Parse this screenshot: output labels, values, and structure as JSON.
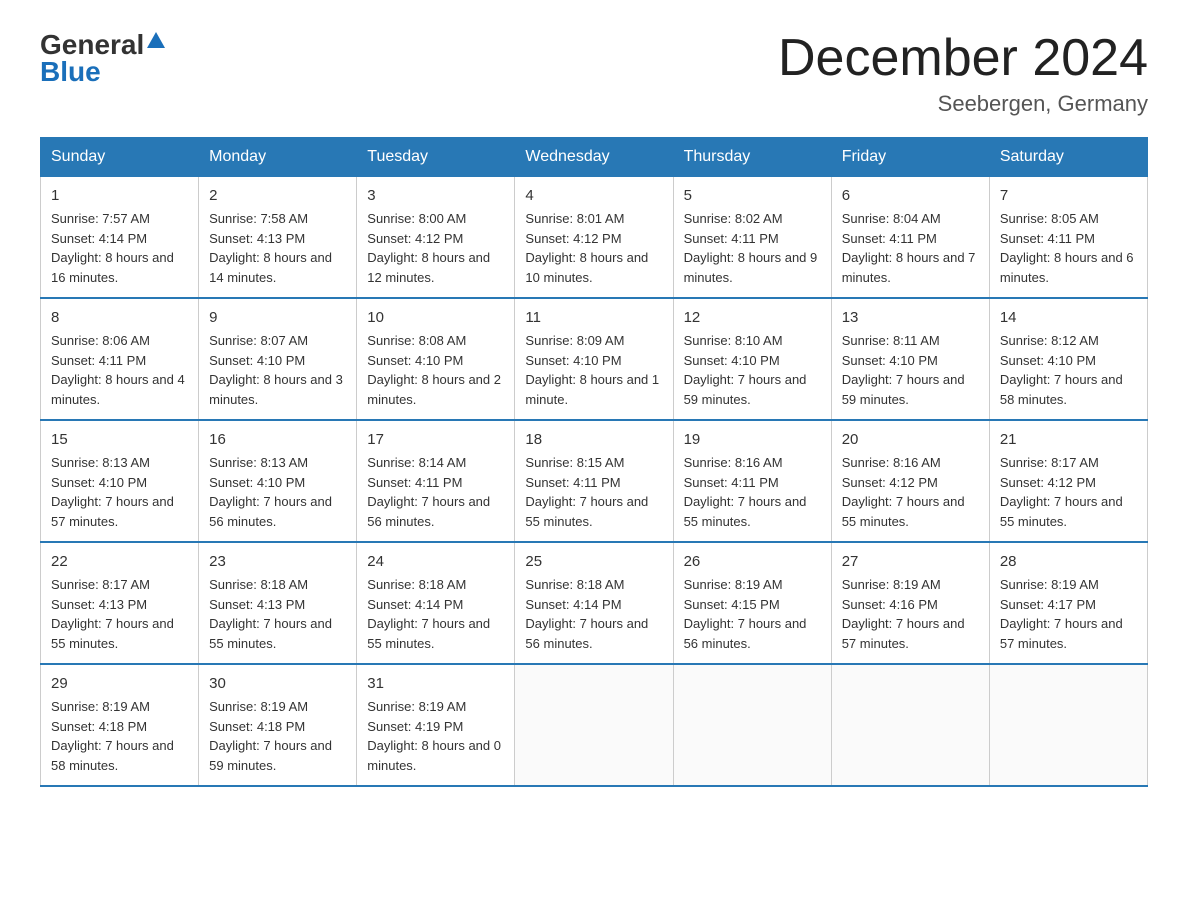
{
  "header": {
    "logo_general": "General",
    "logo_blue": "Blue",
    "month_title": "December 2024",
    "location": "Seebergen, Germany"
  },
  "weekdays": [
    "Sunday",
    "Monday",
    "Tuesday",
    "Wednesday",
    "Thursday",
    "Friday",
    "Saturday"
  ],
  "weeks": [
    [
      {
        "day": "1",
        "sunrise": "7:57 AM",
        "sunset": "4:14 PM",
        "daylight": "8 hours and 16 minutes."
      },
      {
        "day": "2",
        "sunrise": "7:58 AM",
        "sunset": "4:13 PM",
        "daylight": "8 hours and 14 minutes."
      },
      {
        "day": "3",
        "sunrise": "8:00 AM",
        "sunset": "4:12 PM",
        "daylight": "8 hours and 12 minutes."
      },
      {
        "day": "4",
        "sunrise": "8:01 AM",
        "sunset": "4:12 PM",
        "daylight": "8 hours and 10 minutes."
      },
      {
        "day": "5",
        "sunrise": "8:02 AM",
        "sunset": "4:11 PM",
        "daylight": "8 hours and 9 minutes."
      },
      {
        "day": "6",
        "sunrise": "8:04 AM",
        "sunset": "4:11 PM",
        "daylight": "8 hours and 7 minutes."
      },
      {
        "day": "7",
        "sunrise": "8:05 AM",
        "sunset": "4:11 PM",
        "daylight": "8 hours and 6 minutes."
      }
    ],
    [
      {
        "day": "8",
        "sunrise": "8:06 AM",
        "sunset": "4:11 PM",
        "daylight": "8 hours and 4 minutes."
      },
      {
        "day": "9",
        "sunrise": "8:07 AM",
        "sunset": "4:10 PM",
        "daylight": "8 hours and 3 minutes."
      },
      {
        "day": "10",
        "sunrise": "8:08 AM",
        "sunset": "4:10 PM",
        "daylight": "8 hours and 2 minutes."
      },
      {
        "day": "11",
        "sunrise": "8:09 AM",
        "sunset": "4:10 PM",
        "daylight": "8 hours and 1 minute."
      },
      {
        "day": "12",
        "sunrise": "8:10 AM",
        "sunset": "4:10 PM",
        "daylight": "7 hours and 59 minutes."
      },
      {
        "day": "13",
        "sunrise": "8:11 AM",
        "sunset": "4:10 PM",
        "daylight": "7 hours and 59 minutes."
      },
      {
        "day": "14",
        "sunrise": "8:12 AM",
        "sunset": "4:10 PM",
        "daylight": "7 hours and 58 minutes."
      }
    ],
    [
      {
        "day": "15",
        "sunrise": "8:13 AM",
        "sunset": "4:10 PM",
        "daylight": "7 hours and 57 minutes."
      },
      {
        "day": "16",
        "sunrise": "8:13 AM",
        "sunset": "4:10 PM",
        "daylight": "7 hours and 56 minutes."
      },
      {
        "day": "17",
        "sunrise": "8:14 AM",
        "sunset": "4:11 PM",
        "daylight": "7 hours and 56 minutes."
      },
      {
        "day": "18",
        "sunrise": "8:15 AM",
        "sunset": "4:11 PM",
        "daylight": "7 hours and 55 minutes."
      },
      {
        "day": "19",
        "sunrise": "8:16 AM",
        "sunset": "4:11 PM",
        "daylight": "7 hours and 55 minutes."
      },
      {
        "day": "20",
        "sunrise": "8:16 AM",
        "sunset": "4:12 PM",
        "daylight": "7 hours and 55 minutes."
      },
      {
        "day": "21",
        "sunrise": "8:17 AM",
        "sunset": "4:12 PM",
        "daylight": "7 hours and 55 minutes."
      }
    ],
    [
      {
        "day": "22",
        "sunrise": "8:17 AM",
        "sunset": "4:13 PM",
        "daylight": "7 hours and 55 minutes."
      },
      {
        "day": "23",
        "sunrise": "8:18 AM",
        "sunset": "4:13 PM",
        "daylight": "7 hours and 55 minutes."
      },
      {
        "day": "24",
        "sunrise": "8:18 AM",
        "sunset": "4:14 PM",
        "daylight": "7 hours and 55 minutes."
      },
      {
        "day": "25",
        "sunrise": "8:18 AM",
        "sunset": "4:14 PM",
        "daylight": "7 hours and 56 minutes."
      },
      {
        "day": "26",
        "sunrise": "8:19 AM",
        "sunset": "4:15 PM",
        "daylight": "7 hours and 56 minutes."
      },
      {
        "day": "27",
        "sunrise": "8:19 AM",
        "sunset": "4:16 PM",
        "daylight": "7 hours and 57 minutes."
      },
      {
        "day": "28",
        "sunrise": "8:19 AM",
        "sunset": "4:17 PM",
        "daylight": "7 hours and 57 minutes."
      }
    ],
    [
      {
        "day": "29",
        "sunrise": "8:19 AM",
        "sunset": "4:18 PM",
        "daylight": "7 hours and 58 minutes."
      },
      {
        "day": "30",
        "sunrise": "8:19 AM",
        "sunset": "4:18 PM",
        "daylight": "7 hours and 59 minutes."
      },
      {
        "day": "31",
        "sunrise": "8:19 AM",
        "sunset": "4:19 PM",
        "daylight": "8 hours and 0 minutes."
      },
      null,
      null,
      null,
      null
    ]
  ]
}
